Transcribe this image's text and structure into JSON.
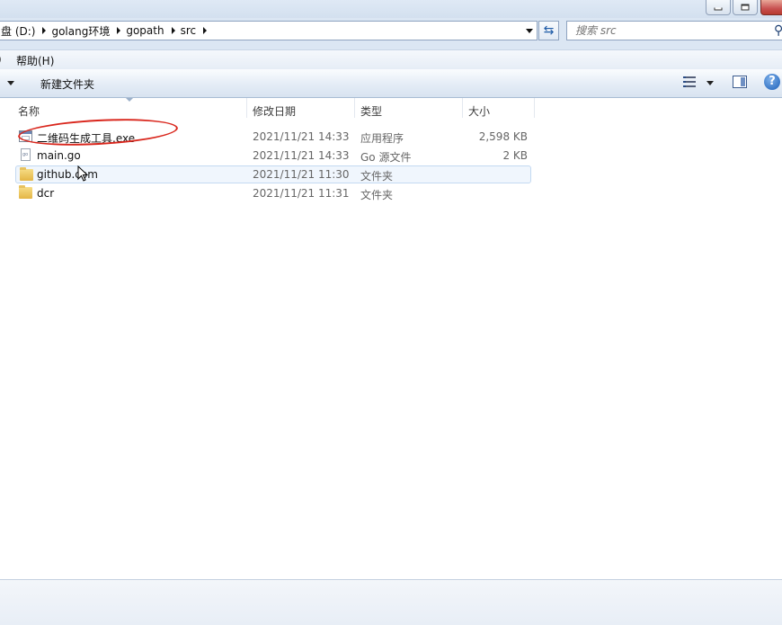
{
  "address": {
    "crumbs": [
      "盘 (D:)",
      "golang环境",
      "gopath",
      "src"
    ]
  },
  "search": {
    "placeholder": "搜索 src"
  },
  "menu": {
    "items": [
      "帮助(H)"
    ]
  },
  "toolbar": {
    "new_folder_label": "新建文件夹"
  },
  "columns": {
    "name": "名称",
    "date": "修改日期",
    "type": "类型",
    "size": "大小"
  },
  "files": [
    {
      "name": "二维码生成工具.exe",
      "date": "2021/11/21 14:33",
      "type": "应用程序",
      "size": "2,598 KB",
      "icon": "exe-icon"
    },
    {
      "name": "main.go",
      "date": "2021/11/21 14:33",
      "type": "Go 源文件",
      "size": "2 KB",
      "icon": "go-file-icon"
    },
    {
      "name": "github.com",
      "date": "2021/11/21 11:30",
      "type": "文件夹",
      "size": "",
      "icon": "folder-icon"
    },
    {
      "name": "dcr",
      "date": "2021/11/21 11:31",
      "type": "文件夹",
      "size": "",
      "icon": "folder-icon"
    }
  ],
  "colors": {
    "annotation": "#d9261c",
    "hover_row": "#f0f6fd"
  }
}
